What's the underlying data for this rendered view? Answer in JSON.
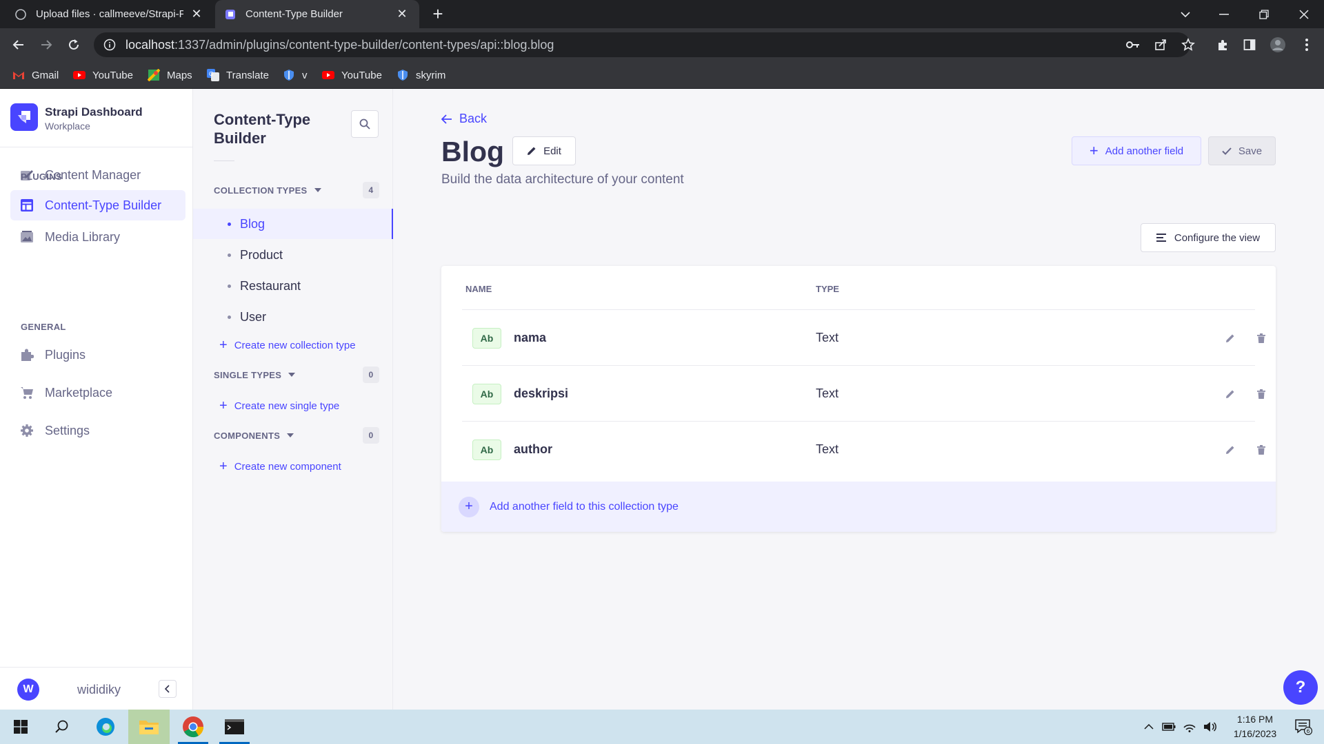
{
  "browser": {
    "tabs": [
      {
        "title": "Upload files · callmeeve/Strapi-Pr",
        "active": false
      },
      {
        "title": "Content-Type Builder",
        "active": true
      }
    ],
    "url_host": "localhost",
    "url_path": ":1337/admin/plugins/content-type-builder/content-types/api::blog.blog",
    "bookmarks": [
      {
        "label": "Gmail",
        "icon": "gmail-icon"
      },
      {
        "label": "YouTube",
        "icon": "youtube-icon"
      },
      {
        "label": "Maps",
        "icon": "maps-icon"
      },
      {
        "label": "Translate",
        "icon": "translate-icon"
      },
      {
        "label": "v",
        "icon": "shield-icon"
      },
      {
        "label": "YouTube",
        "icon": "youtube-icon"
      },
      {
        "label": "skyrim",
        "icon": "shield-icon"
      }
    ]
  },
  "mainnav": {
    "brand_title": "Strapi Dashboard",
    "brand_subtitle": "Workplace",
    "items": [
      {
        "label": "Content Manager",
        "icon": "pen-icon"
      },
      {
        "label": "Content-Type Builder",
        "icon": "layout-icon",
        "active": true
      },
      {
        "label": "Media Library",
        "icon": "image-icon"
      },
      {
        "label": "Plugins",
        "icon": "puzzle-icon"
      },
      {
        "label": "Marketplace",
        "icon": "cart-icon"
      },
      {
        "label": "Settings",
        "icon": "gear-icon"
      }
    ],
    "section_plugins": "PLUGINS",
    "section_general": "GENERAL",
    "user_initial": "W",
    "username": "wididiky"
  },
  "subnav": {
    "title": "Content-Type Builder",
    "collection_types": {
      "label": "COLLECTION TYPES",
      "count": "4",
      "items": [
        "Blog",
        "Product",
        "Restaurant",
        "User"
      ],
      "create_label": "Create new collection type"
    },
    "single_types": {
      "label": "SINGLE TYPES",
      "count": "0",
      "create_label": "Create new single type"
    },
    "components": {
      "label": "COMPONENTS",
      "count": "0",
      "create_label": "Create new component"
    }
  },
  "main": {
    "back_label": "Back",
    "title": "Blog",
    "edit_label": "Edit",
    "subtitle": "Build the data architecture of your content",
    "add_field_label": "Add another field",
    "save_label": "Save",
    "configure_label": "Configure the view",
    "table": {
      "col_name": "NAME",
      "col_type": "TYPE",
      "rows": [
        {
          "badge": "Ab",
          "name": "nama",
          "type": "Text"
        },
        {
          "badge": "Ab",
          "name": "deskripsi",
          "type": "Text"
        },
        {
          "badge": "Ab",
          "name": "author",
          "type": "Text"
        }
      ]
    },
    "add_row_label": "Add another field to this collection type",
    "help_label": "?"
  },
  "taskbar": {
    "time": "1:16 PM",
    "date": "1/16/2023",
    "notification_count": "6"
  },
  "colors": {
    "primary": "#4945ff",
    "primary_light": "#f0f0ff",
    "text": "#32324d",
    "muted": "#666687"
  }
}
